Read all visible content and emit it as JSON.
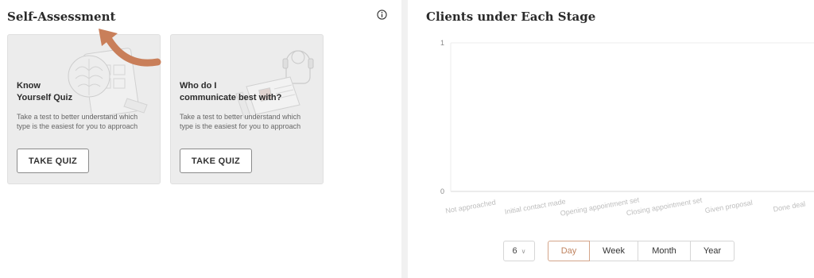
{
  "self_assessment": {
    "title": "Self-Assessment",
    "accent_color": "#c97f5a",
    "cards": [
      {
        "title_line1": "Know",
        "title_line2": "Yourself Quiz",
        "description": "Take a test to better understand which type is the easiest for you to approach",
        "button_label": "TAKE QUIZ",
        "illustration_icon": "brain-tablet-illustration"
      },
      {
        "title_line1": "Who do I",
        "title_line2": "communicate best with?",
        "description": "Take a test to better understand which type is the easiest for you to approach",
        "button_label": "TAKE QUIZ",
        "illustration_icon": "headset-profile-illustration"
      }
    ]
  },
  "clients_chart": {
    "title": "Clients under Each Stage",
    "count_select": "6",
    "periods": [
      "Day",
      "Week",
      "Month",
      "Year"
    ],
    "active_period": "Day",
    "chart_data": {
      "type": "bar",
      "categories": [
        "Not approached",
        "Initial contact made",
        "Opening appointment set",
        "Closing appointment set",
        "Given proposal",
        "Done deal"
      ],
      "values": [
        0,
        0,
        0,
        0,
        0,
        0
      ],
      "yticks": [
        "1",
        "0"
      ],
      "ylim": [
        0,
        1
      ],
      "grid": true,
      "xlabel": "",
      "ylabel": ""
    }
  }
}
